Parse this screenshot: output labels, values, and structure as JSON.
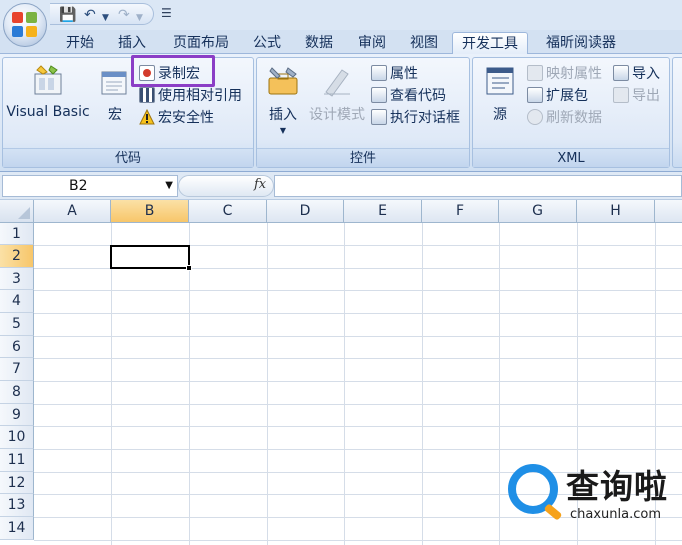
{
  "tabs": [
    "开始",
    "插入",
    "页面布局",
    "公式",
    "数据",
    "审阅",
    "视图",
    "开发工具",
    "福昕阅读器"
  ],
  "active_tab": "开发工具",
  "ribbon": {
    "code": {
      "label": "代码",
      "visual_basic": "Visual Basic",
      "macros": "宏",
      "record_macro": "录制宏",
      "relative_refs": "使用相对引用",
      "macro_security": "宏安全性"
    },
    "controls": {
      "label": "控件",
      "insert": "插入",
      "design_mode": "设计模式",
      "properties": "属性",
      "view_code": "查看代码",
      "run_dialog": "执行对话框"
    },
    "xml": {
      "label": "XML",
      "source": "源",
      "map_properties": "映射属性",
      "expansion_packs": "扩展包",
      "refresh_data": "刷新数据",
      "import": "导入",
      "export": "导出"
    }
  },
  "formula_bar": {
    "name_box": "B2",
    "fx": "fx",
    "value": ""
  },
  "grid": {
    "columns": [
      "A",
      "B",
      "C",
      "D",
      "E",
      "F",
      "G",
      "H"
    ],
    "rows": [
      "1",
      "2",
      "3",
      "4",
      "5",
      "6",
      "7",
      "8",
      "9",
      "10",
      "11",
      "12",
      "13",
      "14"
    ],
    "selected_cell": "B2"
  },
  "watermark": {
    "title": "查询啦",
    "url": "chaxunla.com"
  },
  "colors": {
    "highlight_box": "#8b3ec6",
    "selected_header": "#f7c66a",
    "ribbon_bg": "#dde8f6"
  }
}
